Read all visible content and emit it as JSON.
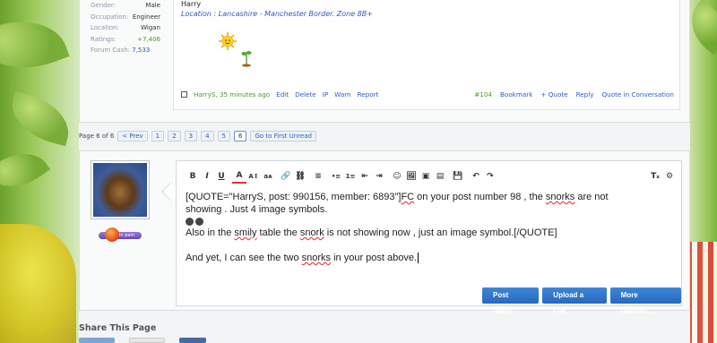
{
  "user_info": {
    "rows": [
      {
        "label": "Gender:",
        "value": "Male"
      },
      {
        "label": "Occupation:",
        "value": "Engineer"
      },
      {
        "label": "Location:",
        "value": "Wigan"
      },
      {
        "label": "Ratings:",
        "value": "+7,406"
      }
    ],
    "cash_label": "Forum Cash:",
    "cash_value": "7,533"
  },
  "post": {
    "signature_name": "Harry",
    "signature_location": "Location : Lancashire - Manchester Border. Zone 8B+",
    "author_time": "HarryS, 35 minutes ago",
    "actions_left": [
      "Edit",
      "Delete",
      "IP",
      "Warn",
      "Report"
    ],
    "post_number": "#104",
    "actions_right": [
      "Bookmark",
      "+ Quote",
      "Reply",
      "Quote in Conversation"
    ]
  },
  "pager": {
    "label": "Page 6 of 6",
    "prev": "< Prev",
    "pages": [
      "1",
      "2",
      "3",
      "4",
      "5",
      "6"
    ],
    "current": "6",
    "first_unread": "Go to First Unread"
  },
  "status": {
    "label": "in pain"
  },
  "editor": {
    "toolbar_left": [
      "B",
      "I",
      "U",
      "A",
      "A↕",
      "aᴀ",
      "🔗",
      "⛓",
      "≡",
      "•≡",
      "1≡",
      "⇤",
      "⇥",
      "☺",
      "🖼",
      "▣",
      "▤",
      "💾",
      "↶",
      "↷"
    ],
    "toolbar_right": [
      "Tₓ",
      "⚙"
    ],
    "line1_a": "[QUOTE=\"HarryS, post: 990156, member: 6893\"]",
    "line1_b": "FC",
    "line1_c": " on your post number 98 , the ",
    "line1_d": "snorks",
    "line1_e": " are not",
    "line2": "showing . Just 4 image symbols.",
    "line3_a": "Also in the ",
    "line3_b": "smily",
    "line3_c": " table the ",
    "line3_d": "snork",
    "line3_e": " is not showing now , just an image symbol.[/QUOTE]",
    "line4_a": "And yet, I can see the two ",
    "line4_b": "snorks",
    "line4_c": " in your post above."
  },
  "buttons": {
    "post_reply": "Post Reply",
    "upload": "Upload a File",
    "more": "More Options..."
  },
  "share": {
    "title": "Share This Page"
  }
}
